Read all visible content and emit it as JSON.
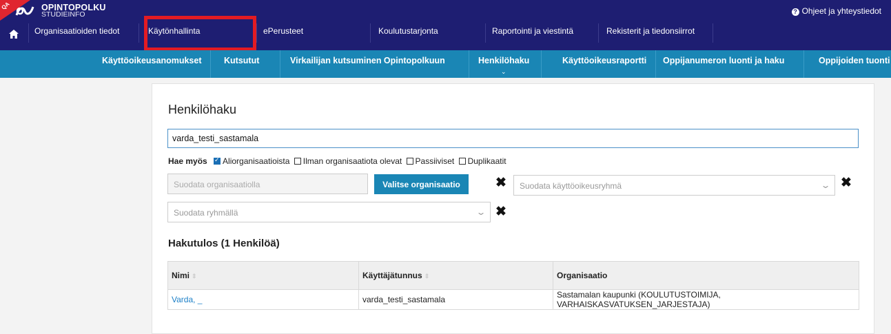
{
  "brand": {
    "ribbon": "QA",
    "title": "OPINTOPOLKU",
    "subtitle": "STUDIEINFO"
  },
  "help": {
    "icon": "question-circle-icon",
    "label": "Ohjeet ja yhteystiedot"
  },
  "top_nav": [
    "Organisaatioiden tiedot",
    "Käytönhallinta",
    "ePerusteet",
    "Koulutustarjonta",
    "Raportointi ja viestintä",
    "Rekisterit ja tiedonsiirrot"
  ],
  "sub_nav": [
    "Käyttöoikeusanomukset",
    "Kutsutut",
    "Virkailijan kutsuminen Opintopolkuun",
    "Henkilöhaku",
    "Käyttöoikeusraportti",
    "Oppijanumeron luonti ja haku",
    "Oppijoiden tuonti"
  ],
  "page": {
    "title": "Henkilöhaku",
    "search_value": "varda_testi_sastamala",
    "hae_label": "Hae myös",
    "options": [
      {
        "label": "Aliorganisaatioista",
        "checked": true
      },
      {
        "label": "Ilman organisaatiota olevat",
        "checked": false
      },
      {
        "label": "Passiiviset",
        "checked": false
      },
      {
        "label": "Duplikaatit",
        "checked": false
      }
    ],
    "org_filter_placeholder": "Suodata organisaatiolla",
    "org_button": "Valitse organisaatio",
    "access_group_placeholder": "Suodata käyttöoikeusryhmä",
    "group_placeholder": "Suodata ryhmällä",
    "result_title": "Hakutulos (1 Henkilöä)"
  },
  "table": {
    "headers": [
      "Nimi",
      "Käyttäjätunnus",
      "Organisaatio"
    ],
    "rows": [
      [
        "Varda, _",
        "varda_testi_sastamala",
        "Sastamalan kaupunki (KOULUTUSTOIMIJA, VARHAISKASVATUKSEN_JARJESTAJA)"
      ]
    ]
  },
  "colors": {
    "top_bar": "#1e1e72",
    "sub_bar": "#1a86b5",
    "highlight": "#e31b23",
    "link": "#1b7fc7"
  }
}
